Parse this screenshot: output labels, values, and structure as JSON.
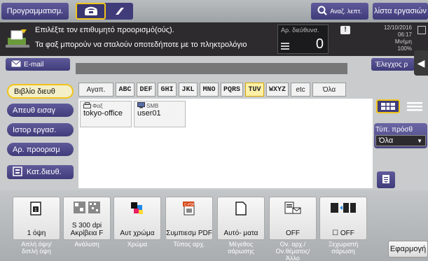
{
  "top_bar": {
    "programs_label": "Προγραμματισμ.",
    "search_label": "Αναζ. λεπτ.",
    "job_list_label": "λίστα εργασιών"
  },
  "message": {
    "line1": "Επιλέξτε τον επιθυμητό προορισμό(ούς).",
    "line2": "Τα φαξ μπορούν να σταλούν οποτεδήποτε με το πληκτρολόγιο",
    "dest_count_label": "Αρ. διεύθυνσ.",
    "dest_count": "0",
    "date": "12/10/2016",
    "time": "06:17",
    "memory_label": "Μνήμη",
    "memory_value": "100%"
  },
  "email_label": "E-mail",
  "check_label": "Έλεγχος ρ",
  "sidebar": {
    "address_book": "Βιβλίο διευθ",
    "direct_input": "Απευθ εισαγ",
    "job_history": "Ιστορ εργασ.",
    "dest_number": "Αρ. προορισμ",
    "category": "Κατ.διευθ."
  },
  "index_tabs": [
    "Αγαπ.",
    "ABC",
    "DEF",
    "GHI",
    "JKL",
    "MNO",
    "PQRS",
    "TUV",
    "WXYZ",
    "etc",
    "Όλα"
  ],
  "selected_tab": "TUV",
  "addresses": [
    {
      "type": "Φαξ",
      "name": "tokyo-office"
    },
    {
      "type": "SMB",
      "name": "user01"
    }
  ],
  "type_filter": {
    "label": "Τύπ. πρόσθ",
    "value": "Όλα"
  },
  "functions": [
    {
      "value": "1 όψη",
      "label": "Απλή όψη/ διπλή όψη",
      "icon": "simplex-icon"
    },
    {
      "value": "S 300 dpi Ακρίβεια F",
      "label": "Ανάλυση",
      "icon": "resolution-icon"
    },
    {
      "value": "Αυτ χρώμα",
      "label": "Χρώμα",
      "icon": "color-icon"
    },
    {
      "value": "Συμπιεσμ PDF",
      "label": "Τύπος αρχ.",
      "icon": "pdf-icon"
    },
    {
      "value": "Αυτό- ματα",
      "label": "Μέγεθος σάρωσης",
      "icon": "scan-size-icon"
    },
    {
      "value": "OFF",
      "label": "Ον. αρχ./ Ον.θέματος/ Άλλο",
      "icon": "filename-icon"
    },
    {
      "value": "OFF",
      "label": "Ξεχωριστή σάρωση",
      "icon": "separate-scan-icon"
    }
  ],
  "apply_label": "Εφαρμογή"
}
